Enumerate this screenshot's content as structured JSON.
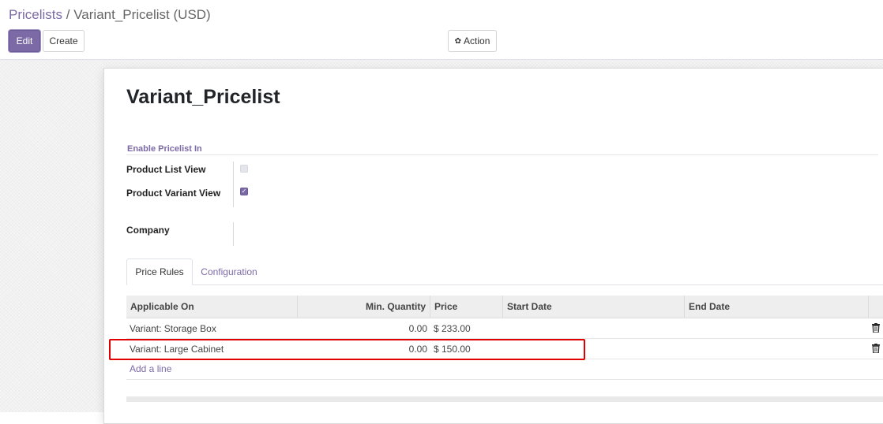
{
  "breadcrumb": {
    "parent": "Pricelists",
    "separator": "/",
    "current": "Variant_Pricelist (USD)"
  },
  "buttons": {
    "edit": "Edit",
    "create": "Create",
    "action": "Action",
    "action_icon": "gear-icon"
  },
  "record": {
    "title": "Variant_Pricelist"
  },
  "enable_group": {
    "title": "Enable Pricelist In",
    "product_list_view_label": "Product List View",
    "product_list_view_checked": false,
    "product_variant_view_label": "Product Variant View",
    "product_variant_view_checked": true,
    "company_label": "Company",
    "company_value": ""
  },
  "tabs": [
    {
      "label": "Price Rules",
      "active": true
    },
    {
      "label": "Configuration",
      "active": false
    }
  ],
  "price_rules": {
    "columns": [
      "Applicable On",
      "Min. Quantity",
      "Price",
      "Start Date",
      "End Date"
    ],
    "rows": [
      {
        "applicable_on": "Variant: Storage Box",
        "min_quantity": "0.00",
        "price": "$ 233.00",
        "start_date": "",
        "end_date": ""
      },
      {
        "applicable_on": "Variant: Large Cabinet",
        "min_quantity": "0.00",
        "price": "$ 150.00",
        "start_date": "",
        "end_date": ""
      }
    ],
    "add_line": "Add a line"
  },
  "colors": {
    "accent": "#7c6aa6",
    "highlight": "#e00000"
  }
}
